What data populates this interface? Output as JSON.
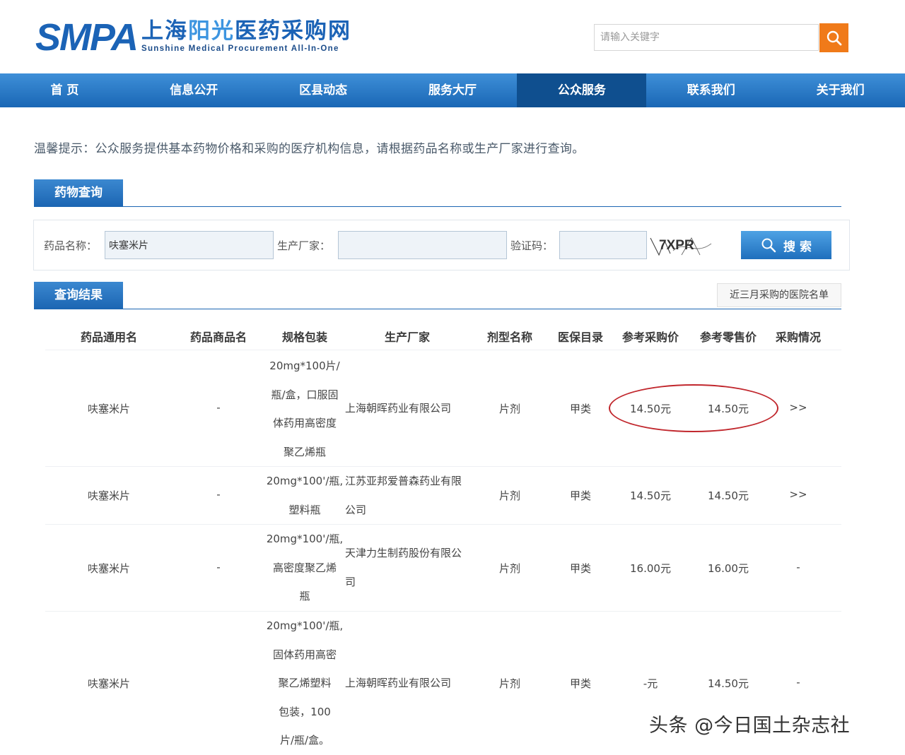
{
  "header": {
    "logo_mark": "SMPA",
    "logo_cn_1": "上海",
    "logo_cn_2": "阳光",
    "logo_cn_3": "医药采购网",
    "logo_en": "Sunshine Medical Procurement All-In-One",
    "search_placeholder": "请输入关键字"
  },
  "nav": {
    "items": [
      "首 页",
      "信息公开",
      "区县动态",
      "服务大厅",
      "公众服务",
      "联系我们",
      "关于我们"
    ],
    "active_index": 4
  },
  "tip": "温馨提示：公众服务提供基本药物价格和采购的医疗机构信息，请根据药品名称或生产厂家进行查询。",
  "query": {
    "section_title": "药物查询",
    "drug_name_label": "药品名称：",
    "drug_name_value": "呋塞米片",
    "manufacturer_label": "生产厂家：",
    "manufacturer_value": "",
    "captcha_label": "验证码：",
    "captcha_value": "",
    "captcha_text": "7XPR",
    "search_button": "搜 索"
  },
  "results": {
    "section_title": "查询结果",
    "recent_button": "近三月采购的医院名单",
    "columns": [
      "药品通用名",
      "药品商品名",
      "规格包装",
      "生产厂家",
      "剂型名称",
      "医保目录",
      "参考采购价",
      "参考零售价",
      "采购情况"
    ],
    "rows": [
      {
        "generic": "呋塞米片",
        "brand": "-",
        "spec": [
          "20mg*100片/",
          "瓶/盒，口服固",
          "体药用高密度",
          "聚乙烯瓶"
        ],
        "maker": [
          "上海朝晖药业有限公司"
        ],
        "form": "片剂",
        "insurance": "甲类",
        "purchase": "14.50元",
        "retail": "14.50元",
        "status": ">>"
      },
      {
        "generic": "呋塞米片",
        "brand": "-",
        "spec": [
          "20mg*100'/瓶,",
          "塑料瓶"
        ],
        "maker": [
          "江苏亚邦爱普森药业有限",
          "公司"
        ],
        "form": "片剂",
        "insurance": "甲类",
        "purchase": "14.50元",
        "retail": "14.50元",
        "status": ">>"
      },
      {
        "generic": "呋塞米片",
        "brand": "-",
        "spec": [
          "20mg*100'/瓶,",
          "高密度聚乙烯",
          "瓶"
        ],
        "maker": [
          "天津力生制药股份有限公",
          "司"
        ],
        "form": "片剂",
        "insurance": "甲类",
        "purchase": "16.00元",
        "retail": "16.00元",
        "status": "-"
      },
      {
        "generic": "呋塞米片",
        "brand": "",
        "spec": [
          "20mg*100'/瓶,",
          "固体药用高密",
          "聚乙烯塑料",
          "包装，100",
          "片/瓶/盒。"
        ],
        "maker": [
          "上海朝晖药业有限公司"
        ],
        "form": "片剂",
        "insurance": "甲类",
        "purchase": "-元",
        "retail": "14.50元",
        "status": "-"
      }
    ]
  },
  "watermark": "头条 @今日国土杂志社",
  "colors": {
    "brand_blue": "#1b63b6",
    "nav_active": "#0f4f8f",
    "search_orange": "#f07a19",
    "annotation_red": "#c1272d"
  }
}
